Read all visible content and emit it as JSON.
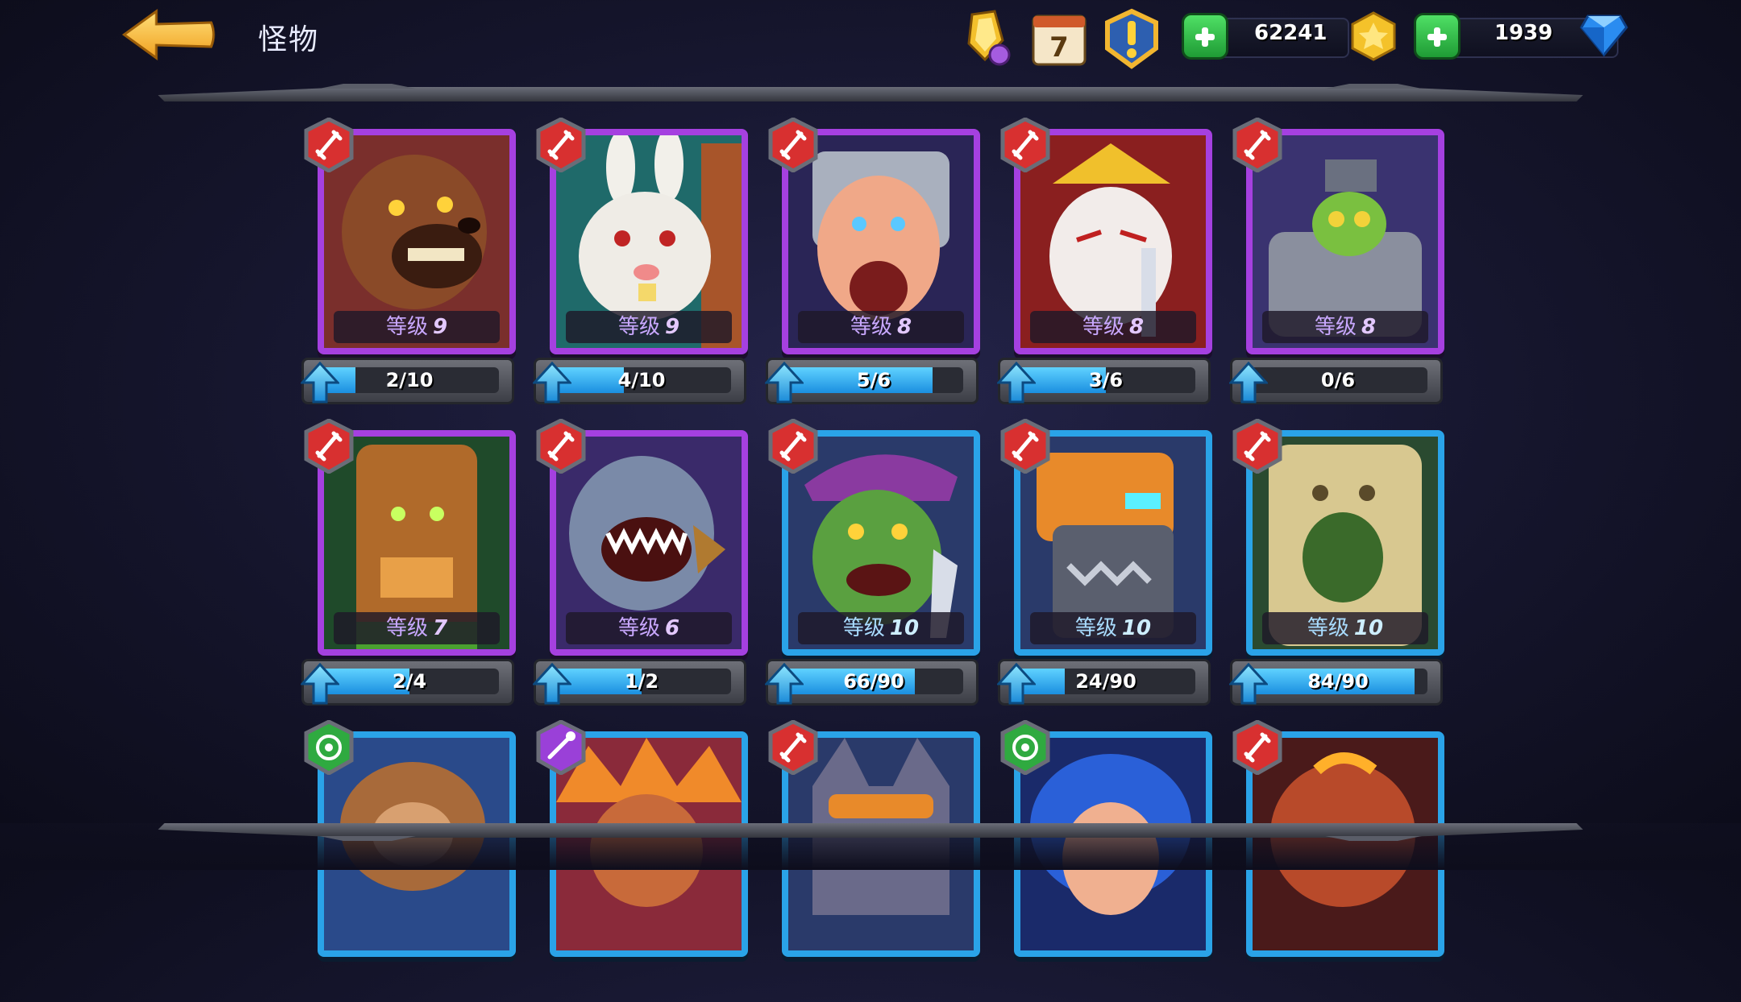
{
  "header": {
    "title": "怪物",
    "gold": "62241",
    "gems": "1939",
    "calendar_day": "7"
  },
  "icons": {
    "back": "back-arrow-icon",
    "trophy": "trophy-crystal-icon",
    "calendar": "calendar-icon",
    "alert": "alert-badge-icon",
    "gold": "gold-coin-icon",
    "gems": "diamond-gem-icon",
    "sword": "sword-class-icon",
    "target": "target-class-icon",
    "magic": "magic-class-icon",
    "upgrade": "upgrade-arrow-icon"
  },
  "colors": {
    "epic_frame": "#a540e0",
    "rare_frame": "#2aa3e8",
    "progress": "#2aa3e8"
  },
  "level_label": "等级",
  "monsters": [
    {
      "name": "bear",
      "level": "9",
      "progress": "2/10",
      "ratio": 0.2,
      "rarity": "epic",
      "cls": "sword"
    },
    {
      "name": "rabbit",
      "level": "9",
      "progress": "4/10",
      "ratio": 0.4,
      "rarity": "epic",
      "cls": "sword"
    },
    {
      "name": "knight",
      "level": "8",
      "progress": "5/6",
      "ratio": 0.83,
      "rarity": "epic",
      "cls": "sword"
    },
    {
      "name": "samurai-fox",
      "level": "8",
      "progress": "3/6",
      "ratio": 0.5,
      "rarity": "epic",
      "cls": "sword"
    },
    {
      "name": "goblin-mech",
      "level": "8",
      "progress": "0/6",
      "ratio": 0,
      "rarity": "epic",
      "cls": "sword"
    },
    {
      "name": "treant",
      "level": "7",
      "progress": "2/4",
      "ratio": 0.5,
      "rarity": "epic",
      "cls": "sword"
    },
    {
      "name": "shark",
      "level": "6",
      "progress": "1/2",
      "ratio": 0.5,
      "rarity": "epic",
      "cls": "sword"
    },
    {
      "name": "pirate-croc",
      "level": "10",
      "progress": "66/90",
      "ratio": 0.73,
      "rarity": "rare",
      "cls": "sword"
    },
    {
      "name": "robot",
      "level": "10",
      "progress": "24/90",
      "ratio": 0.27,
      "rarity": "rare",
      "cls": "sword"
    },
    {
      "name": "stone-golem",
      "level": "10",
      "progress": "84/90",
      "ratio": 0.93,
      "rarity": "rare",
      "cls": "sword"
    },
    {
      "name": "monkey",
      "rarity": "rare",
      "cls": "target"
    },
    {
      "name": "feather-chief",
      "rarity": "rare",
      "cls": "magic"
    },
    {
      "name": "wolf",
      "rarity": "rare",
      "cls": "sword"
    },
    {
      "name": "blue-hair",
      "rarity": "rare",
      "cls": "target"
    },
    {
      "name": "lava-beast",
      "rarity": "rare",
      "cls": "sword"
    }
  ]
}
